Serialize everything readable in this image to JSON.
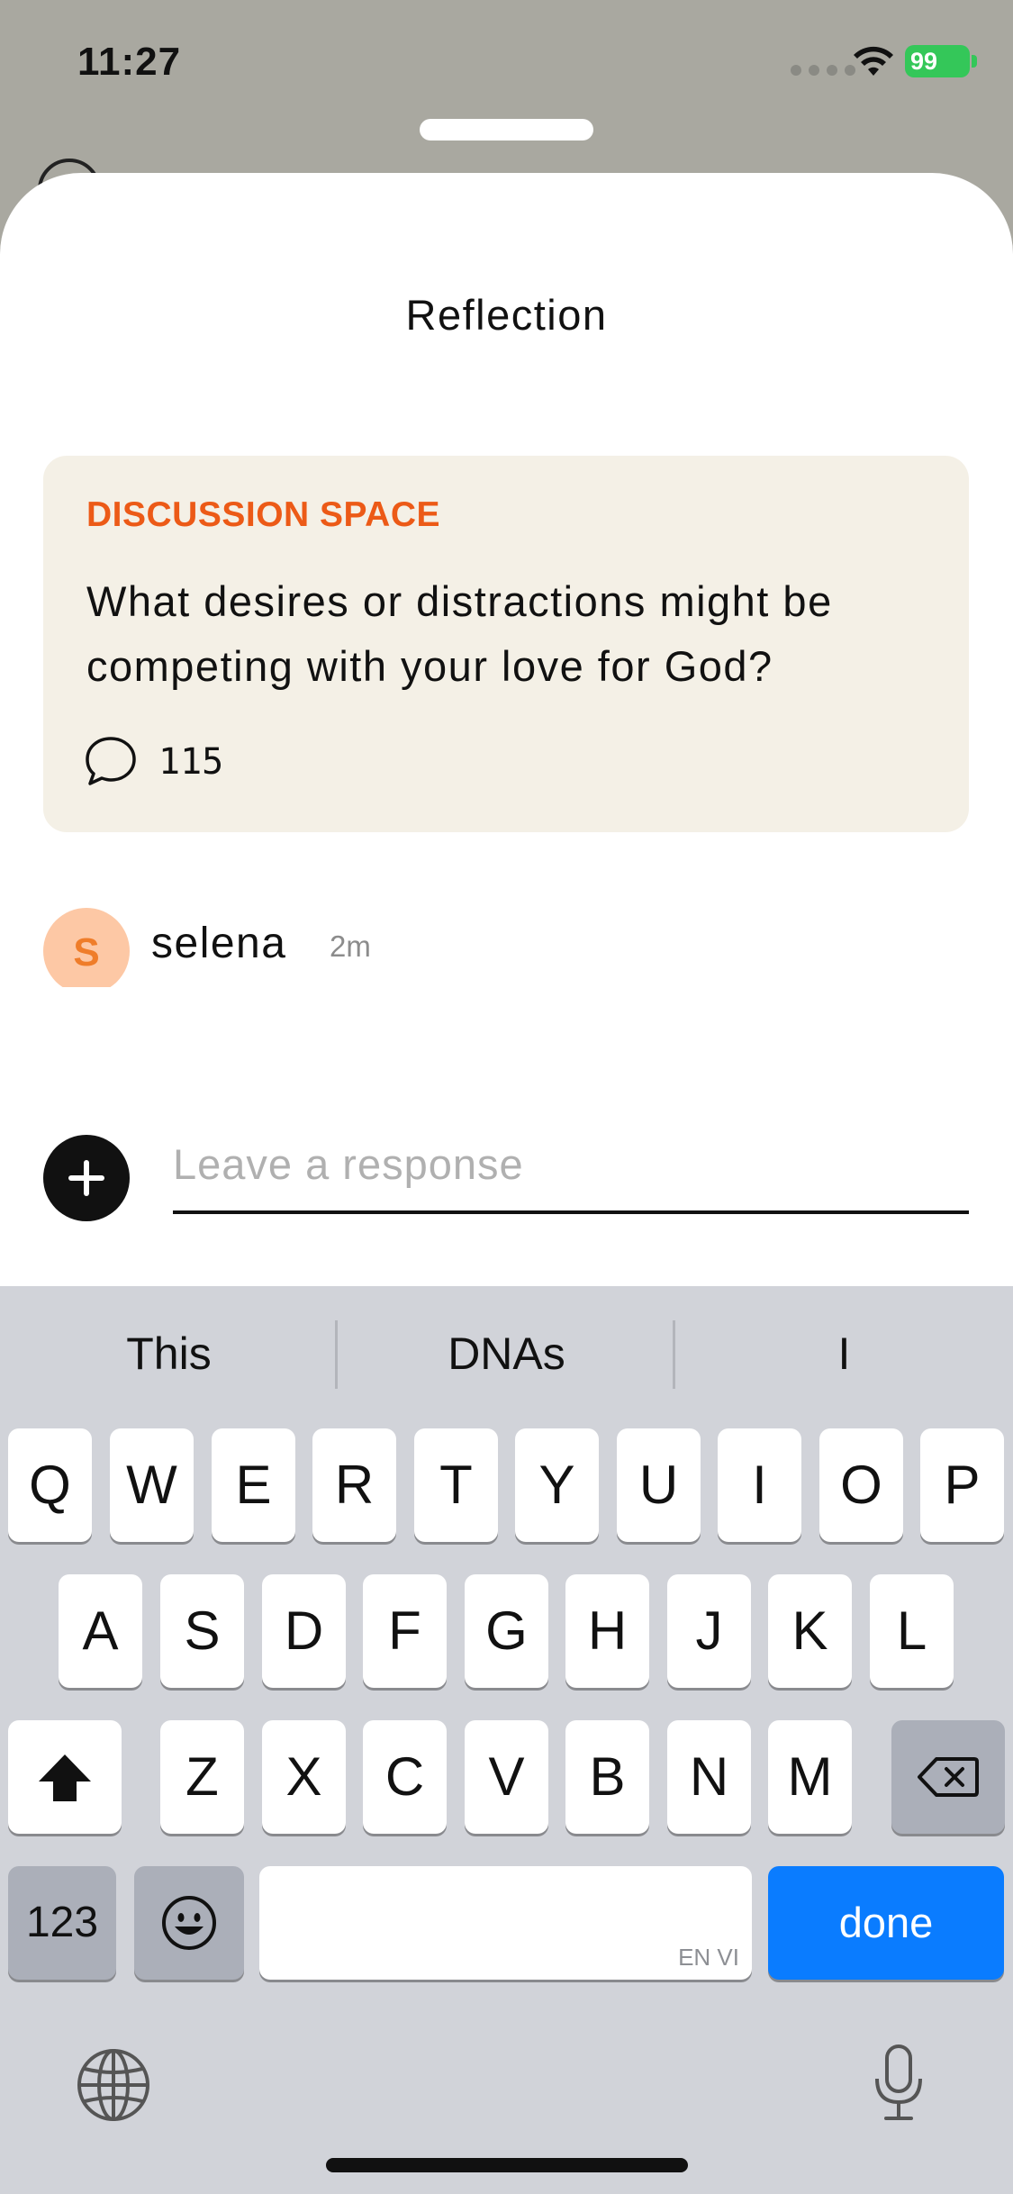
{
  "status_bar": {
    "time": "11:27",
    "battery": "99"
  },
  "sheet": {
    "title": "Reflection",
    "discussion": {
      "label": "DISCUSSION SPACE",
      "question": "What desires or distractions might be competing with your love for God?",
      "comment_count": "115"
    },
    "comment": {
      "avatar_initial": "S",
      "username": "selena",
      "time_ago": "2m"
    },
    "response": {
      "placeholder": "Leave a response"
    }
  },
  "keyboard": {
    "suggestions": [
      "This",
      "DNAs",
      "I"
    ],
    "row1": [
      "Q",
      "W",
      "E",
      "R",
      "T",
      "Y",
      "U",
      "I",
      "O",
      "P"
    ],
    "row2": [
      "A",
      "S",
      "D",
      "F",
      "G",
      "H",
      "J",
      "K",
      "L"
    ],
    "row3": [
      "Z",
      "X",
      "C",
      "V",
      "B",
      "N",
      "M"
    ],
    "numbers_label": "123",
    "space_language": "EN VI",
    "done_label": "done"
  },
  "colors": {
    "accent": "#ec5a17",
    "card_bg": "#f4f0e6",
    "done_button": "#0a7cff",
    "avatar_bg": "#fdc8a5"
  }
}
